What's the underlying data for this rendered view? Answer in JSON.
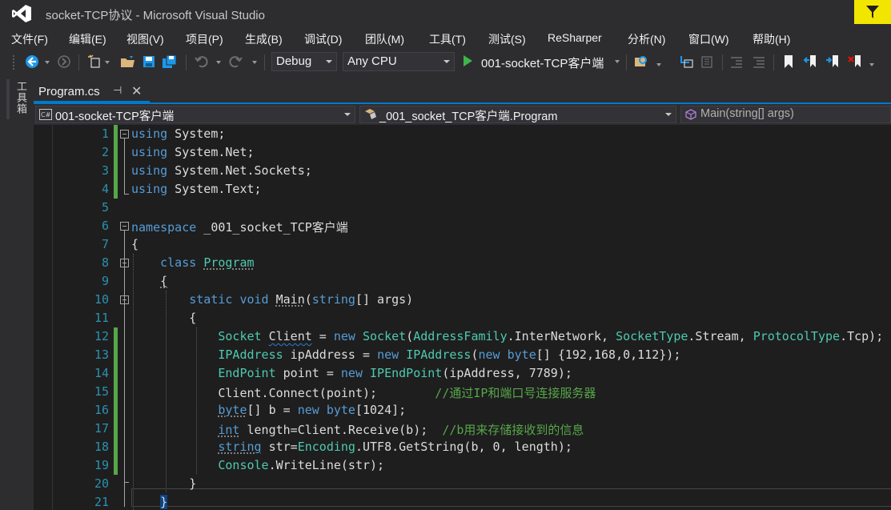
{
  "window": {
    "title": "socket-TCP协议 - Microsoft Visual Studio"
  },
  "menu": [
    "文件(F)",
    "编辑(E)",
    "视图(V)",
    "项目(P)",
    "生成(B)",
    "调试(D)",
    "团队(M)",
    "工具(T)",
    "测试(S)",
    "ReSharper",
    "分析(N)",
    "窗口(W)",
    "帮助(H)"
  ],
  "toolbar": {
    "config": "Debug",
    "platform": "Any CPU",
    "start_label": "001-socket-TCP客户端"
  },
  "side_panel": {
    "toolbox_label": "工具箱"
  },
  "tab": {
    "name": "Program.cs",
    "pin": "⊣",
    "close": "✕"
  },
  "nav": {
    "project": "001-socket-TCP客户端",
    "class": "_001_socket_TCP客户端.Program",
    "member": "Main(string[] args)"
  },
  "colors": {
    "accent": "#007acc",
    "notify": "#f2e600",
    "keyword": "#569cd6",
    "type": "#4ec9b0",
    "comment": "#57a64a",
    "line_number": "#2b91af"
  },
  "lines": [
    "1",
    "2",
    "3",
    "4",
    "5",
    "6",
    "7",
    "8",
    "9",
    "10",
    "11",
    "12",
    "13",
    "14",
    "15",
    "16",
    "17",
    "18",
    "19",
    "20",
    "21"
  ]
}
